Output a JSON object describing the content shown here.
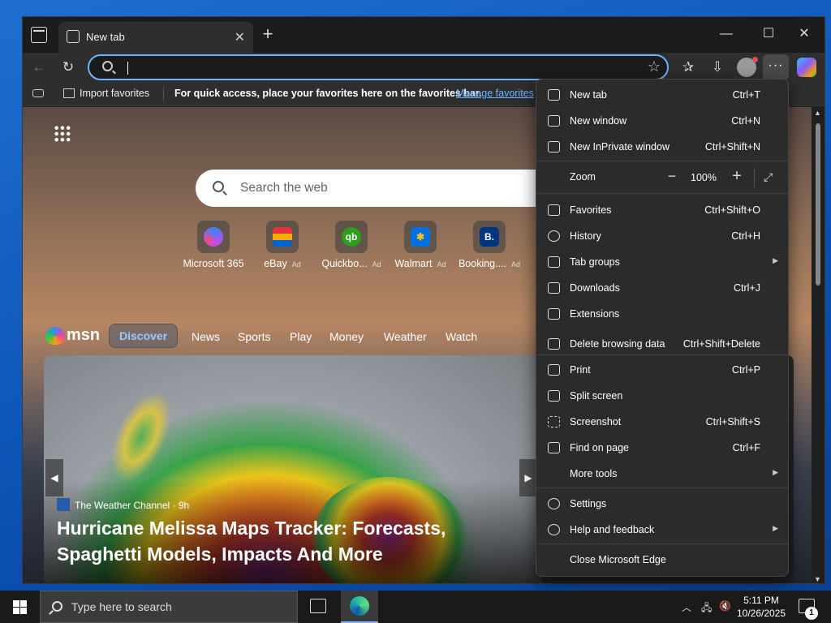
{
  "tab": {
    "title": "New tab"
  },
  "favorites_bar": {
    "import_label": "Import favorites",
    "message": "For quick access, place your favorites here on the favorites bar.",
    "manage_link": "Manage favorites"
  },
  "newtab": {
    "search_placeholder": "Search the web",
    "quick_links": [
      {
        "label": "Microsoft 365",
        "ad": "",
        "color": "#3a6fd8",
        "glyph": ""
      },
      {
        "label": "eBay",
        "ad": "Ad",
        "color": "#f0c000",
        "glyph": ""
      },
      {
        "label": "Quickbo...",
        "ad": "Ad",
        "color": "#2ca01c",
        "glyph": "qb"
      },
      {
        "label": "Walmart",
        "ad": "Ad",
        "color": "#0071dc",
        "glyph": "✱"
      },
      {
        "label": "Booking....",
        "ad": "Ad",
        "color": "#003580",
        "glyph": "B."
      }
    ],
    "msn": {
      "logo_text": "msn",
      "nav": [
        "Discover",
        "News",
        "Sports",
        "Play",
        "Money",
        "Weather",
        "Watch"
      ],
      "active": "Discover"
    },
    "hero": {
      "source": "The Weather Channel",
      "age": "9h",
      "title": "Hurricane Melissa Maps Tracker: Forecasts, Spaghetti Models, Impacts And More"
    }
  },
  "menu": {
    "items": [
      {
        "id": "new-tab",
        "label": "New tab",
        "shortcut": "Ctrl+T",
        "arrow": false
      },
      {
        "id": "new-window",
        "label": "New window",
        "shortcut": "Ctrl+N",
        "arrow": false
      },
      {
        "id": "new-inprivate-window",
        "label": "New InPrivate window",
        "shortcut": "Ctrl+Shift+N",
        "arrow": false
      },
      {
        "id": "favorites",
        "label": "Favorites",
        "shortcut": "Ctrl+Shift+O",
        "arrow": false
      },
      {
        "id": "history",
        "label": "History",
        "shortcut": "Ctrl+H",
        "arrow": false
      },
      {
        "id": "tab-groups",
        "label": "Tab groups",
        "shortcut": "",
        "arrow": true
      },
      {
        "id": "downloads",
        "label": "Downloads",
        "shortcut": "Ctrl+J",
        "arrow": false
      },
      {
        "id": "extensions",
        "label": "Extensions",
        "shortcut": "",
        "arrow": false
      },
      {
        "id": "delete-browsing-data",
        "label": "Delete browsing data",
        "shortcut": "Ctrl+Shift+Delete",
        "arrow": false
      },
      {
        "id": "print",
        "label": "Print",
        "shortcut": "Ctrl+P",
        "arrow": false
      },
      {
        "id": "split-screen",
        "label": "Split screen",
        "shortcut": "",
        "arrow": false
      },
      {
        "id": "screenshot",
        "label": "Screenshot",
        "shortcut": "Ctrl+Shift+S",
        "arrow": false
      },
      {
        "id": "find-on-page",
        "label": "Find on page",
        "shortcut": "Ctrl+F",
        "arrow": false
      },
      {
        "id": "more-tools",
        "label": "More tools",
        "shortcut": "",
        "arrow": true
      },
      {
        "id": "settings",
        "label": "Settings",
        "shortcut": "",
        "arrow": false
      },
      {
        "id": "help-and-feedback",
        "label": "Help and feedback",
        "shortcut": "",
        "arrow": true
      },
      {
        "id": "close-microsoft-edge",
        "label": "Close Microsoft Edge",
        "shortcut": "",
        "arrow": false
      }
    ],
    "zoom": {
      "label": "Zoom",
      "value": "100%"
    }
  },
  "taskbar": {
    "search_placeholder": "Type here to search",
    "time": "5:11 PM",
    "date": "10/26/2025",
    "notification_count": "1"
  }
}
